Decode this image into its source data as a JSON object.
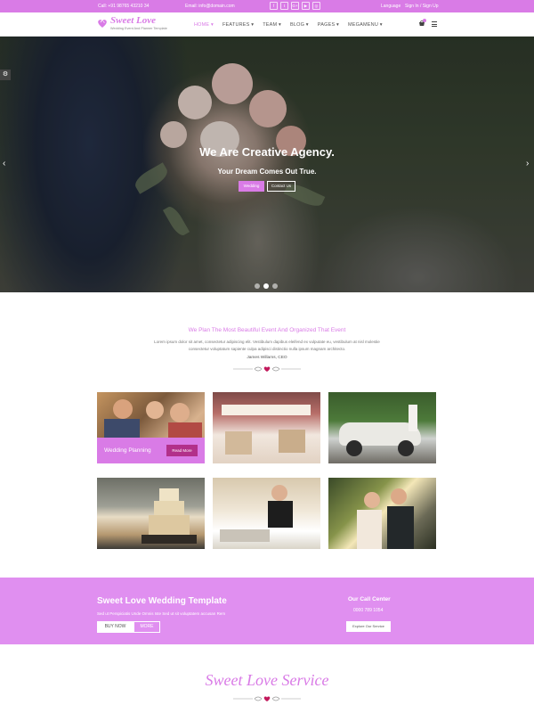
{
  "topbar": {
    "call": "Call: +91 98765 43210 34",
    "email": "Email: info@domain.com",
    "socials": [
      {
        "icon": "facebook-icon",
        "glyph": "f"
      },
      {
        "icon": "twitter-icon",
        "glyph": "t"
      },
      {
        "icon": "google-plus-icon",
        "glyph": "G+"
      },
      {
        "icon": "youtube-icon",
        "glyph": "▶"
      },
      {
        "icon": "instagram-icon",
        "glyph": "◎"
      }
    ],
    "language": "Language",
    "sign": "Sign In / Sign Up"
  },
  "header": {
    "logo_title": "Sweet Love",
    "logo_tagline": "Wedding Event And Planner Template",
    "nav": [
      "HOME ▾",
      "FEATURES ▾",
      "TEAM ▾",
      "BLOG ▾",
      "PAGES ▾",
      "MEGAMENU ▾"
    ],
    "cart_icon": "cart-icon",
    "menu_icon": "hamburger-menu-icon"
  },
  "hero": {
    "title": "We Are Creative Agency.",
    "subtitle": "Your Dream Comes Out True.",
    "btn_primary": "Wedding",
    "btn_secondary": "Contact Us",
    "prev": "‹",
    "next": "›",
    "settings": "⚙",
    "active_slide": 2,
    "slide_count": 3
  },
  "intro": {
    "title": "We Plan The Most Beautiful Event And Organized That Event",
    "text": "Lorem ipsum dolor sit amet, consectetur adipiscing elit. Vestibulum dapibus eleifend ex vulputate eu, vestibulum at nisl molestie consectetur voluptatum sapiente culpa adipisci distinctio nulla ipsum magnam architecto.",
    "author": "James Willams, CEO"
  },
  "gallery": {
    "overlay_label": "Wedding Planning",
    "read_more": "Read More"
  },
  "cta": {
    "title": "Sweet Love Wedding Template",
    "subtitle": "Sed ut Perspiciatis Unde Omnis Iste Sed ut sit voluptatem accusan Rem",
    "buy": "BUY NOW",
    "more": "MORE",
    "call_title": "Our Call Center",
    "phone": "0000 789 1054",
    "explore": "Explore Our Service"
  },
  "footer": {
    "service_title": "Sweet Love Service"
  },
  "colors": {
    "accent": "#d97be6",
    "cta_band": "#e08ff0",
    "read_more": "#b2308a"
  }
}
